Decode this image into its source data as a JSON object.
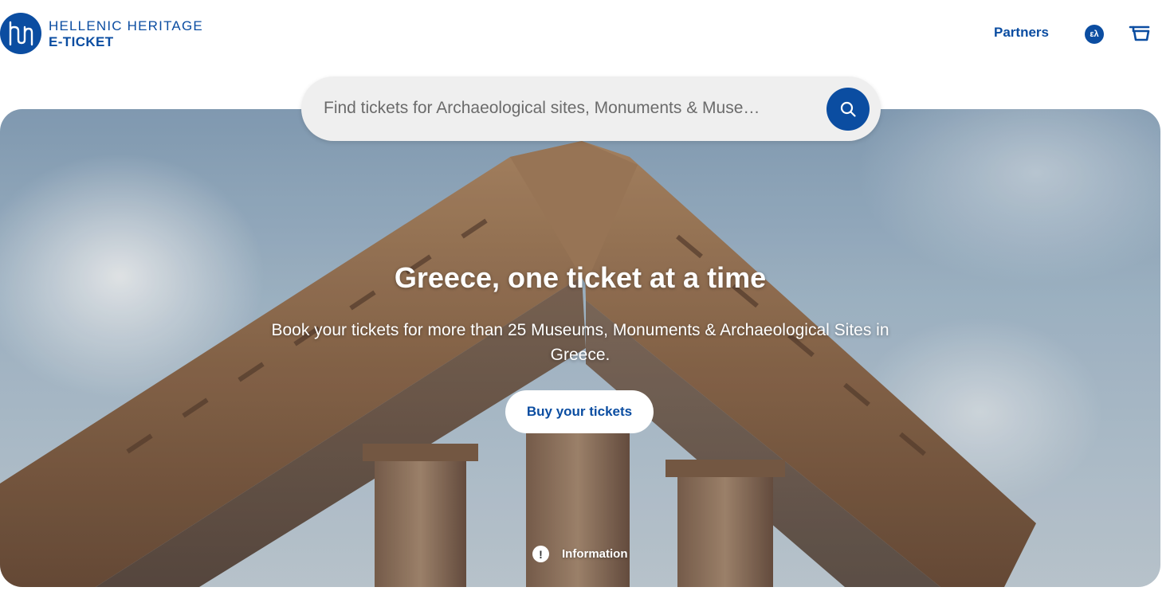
{
  "brand": {
    "line1": "HELLENIC HERITAGE",
    "line2": "E-TICKET",
    "logo_icon": "hh-monogram-icon",
    "color": "#0b4da1"
  },
  "nav": {
    "partners_label": "Partners",
    "language_label": "ελ",
    "cart_icon": "cart-icon"
  },
  "search": {
    "placeholder": "Find tickets for Archaeological sites, Monuments & Muse…",
    "value": "",
    "button_icon": "search-icon"
  },
  "hero": {
    "title": "Greece, one ticket at a time",
    "subtitle": "Book your tickets for more than 25 Museums, Monuments & Archaeological Sites in Greece.",
    "cta_label": "Buy your tickets",
    "info_label": "Information",
    "info_icon": "exclamation-icon",
    "image": "parthenon-columns-photo"
  }
}
